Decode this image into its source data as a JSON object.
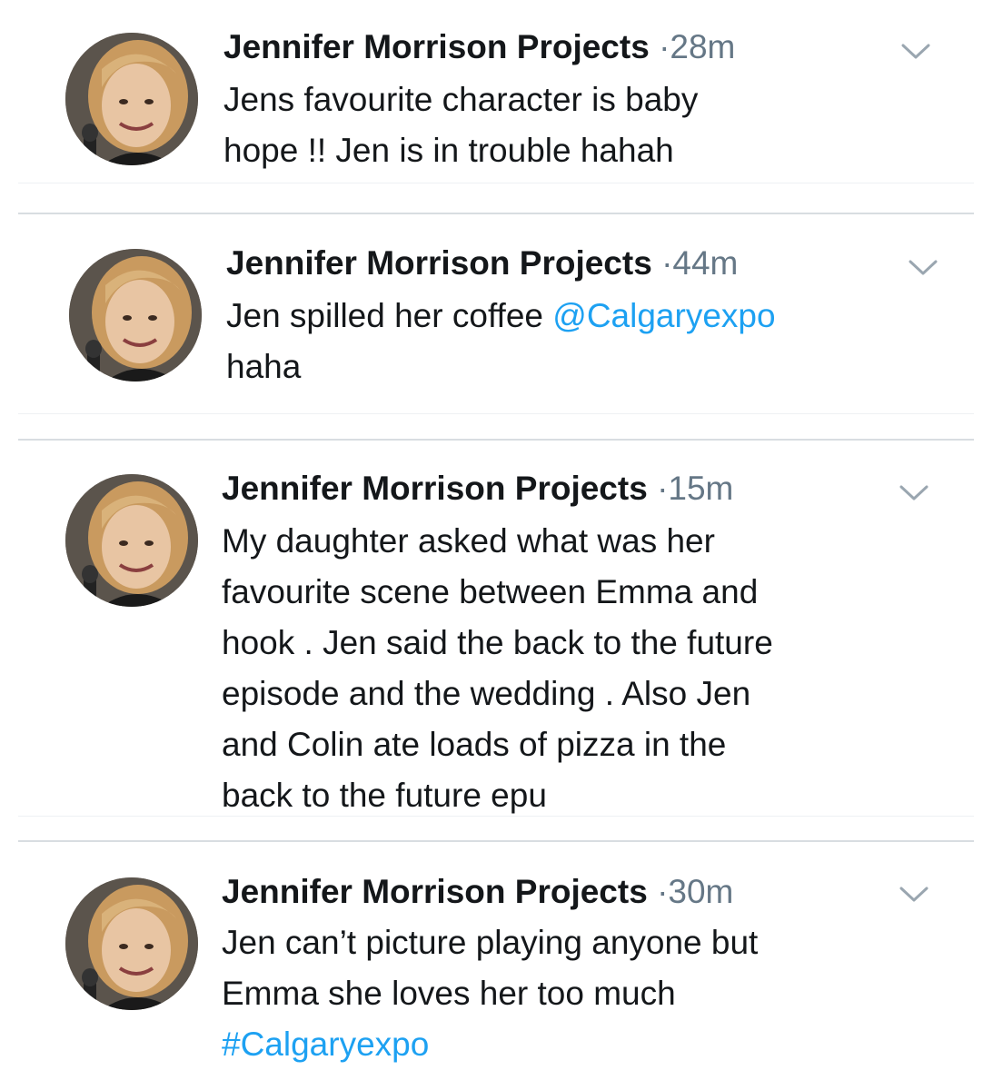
{
  "tweets": [
    {
      "author": "Jennifer Morrison Projects",
      "separator": "·",
      "time": "28m",
      "lines": [
        {
          "text": "Jens favourite character is baby"
        },
        {
          "text": "hope !!  Jen is in trouble hahah"
        }
      ]
    },
    {
      "author": "Jennifer Morrison Projects",
      "separator": "·",
      "time": "44m",
      "lines": [
        {
          "text": "Jen spilled her coffee ",
          "link": "@Calgaryexpo"
        },
        {
          "text": "haha"
        }
      ]
    },
    {
      "author": "Jennifer Morrison Projects",
      "separator": "·",
      "time": "15m",
      "lines": [
        {
          "text": "My daughter asked what was her"
        },
        {
          "text": "favourite scene between Emma and"
        },
        {
          "text": "hook . Jen said the back to the future"
        },
        {
          "text": "episode and the wedding . Also Jen"
        },
        {
          "text": "and Colin ate loads of pizza in the"
        },
        {
          "text": "back to the future epu"
        }
      ]
    },
    {
      "author": "Jennifer Morrison Projects",
      "separator": "·",
      "time": "30m",
      "lines": [
        {
          "text": "Jen can’t picture playing anyone but"
        },
        {
          "text": "Emma she loves her too much"
        },
        {
          "text": "",
          "link": "#Calgaryexpo"
        }
      ]
    }
  ],
  "icons": {
    "avatar": "profile-photo-icon",
    "menu": "chevron-down-icon"
  },
  "colors": {
    "name": "#14171a",
    "meta": "#657786",
    "link": "#1da1f2",
    "divider": "#d8dde1"
  }
}
